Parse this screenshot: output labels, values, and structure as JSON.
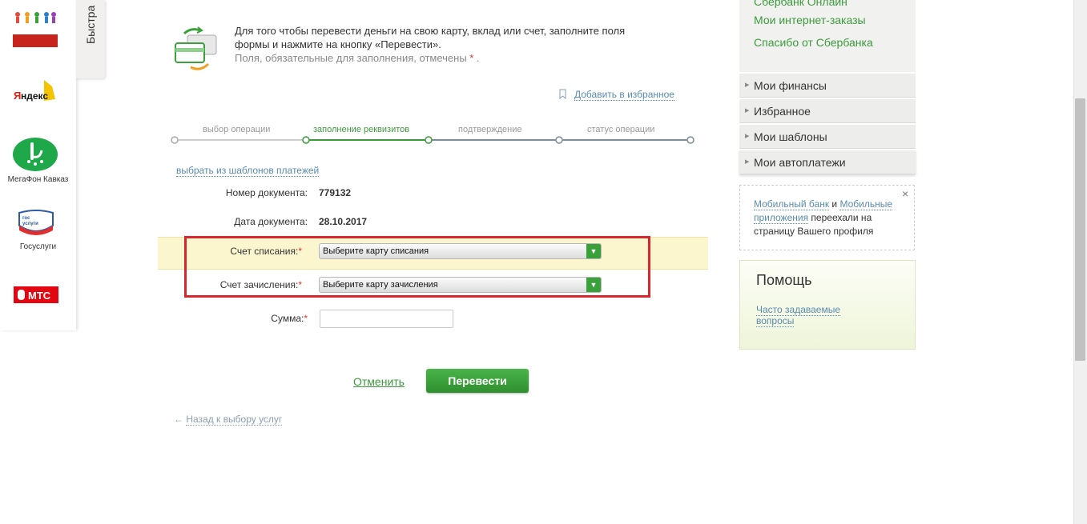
{
  "left_sidebar": {
    "quick_tab": "Быстра",
    "services": [
      {
        "name": "МегаФон Кавказ"
      },
      {
        "name": "Госуслуги"
      }
    ],
    "logos": [
      "Яндекс",
      "МТС",
      "гос услуги"
    ]
  },
  "intro": {
    "line1": "Для того чтобы перевести деньги на свою карту, вклад или счет, заполните поля",
    "line2": "формы и нажмите на кнопку «Перевести».",
    "note": "Поля, обязательные для заполнения, отмечены",
    "star": "*",
    "dot": "."
  },
  "favorite_link": "Добавить в избранное",
  "steps": [
    "выбор операции",
    "заполнение реквизитов",
    "подтверждение",
    "статус операции"
  ],
  "template_link": "выбрать из шаблонов платежей",
  "form": {
    "doc_number_label": "Номер документа:",
    "doc_number_value": "779132",
    "doc_date_label": "Дата документа:",
    "doc_date_value": "28.10.2017",
    "debit_label": "Счет списания:",
    "debit_placeholder": "Выберите карту списания",
    "credit_label": "Счет зачисления:",
    "credit_placeholder": "Выберите карту зачисления",
    "amount_label": "Сумма:",
    "required": "*"
  },
  "buttons": {
    "cancel": "Отменить",
    "submit": "Перевести"
  },
  "back_link": {
    "arrow": "←",
    "text": "Назад к выбору услуг"
  },
  "right_sidebar": {
    "links": [
      "Сбербанк Онлайн",
      "Мои интернет-заказы",
      "Спасибо от Сбербанка"
    ],
    "menu": [
      "Мои финансы",
      "Избранное",
      "Мои шаблоны",
      "Мои автоплатежи"
    ],
    "notice": {
      "link1": "Мобильный банк",
      "and": " и ",
      "link2": "Мобильные приложения",
      "text": " переехали на страницу Вашего профиля",
      "close": "×"
    },
    "help": {
      "title": "Помощь",
      "faq_line1": "Часто задаваемые",
      "faq_line2": "вопросы"
    }
  },
  "colors": {
    "accent_green": "#3c9a3c",
    "highlight_red": "#d8262e",
    "link_blue": "#5a8bb0"
  }
}
